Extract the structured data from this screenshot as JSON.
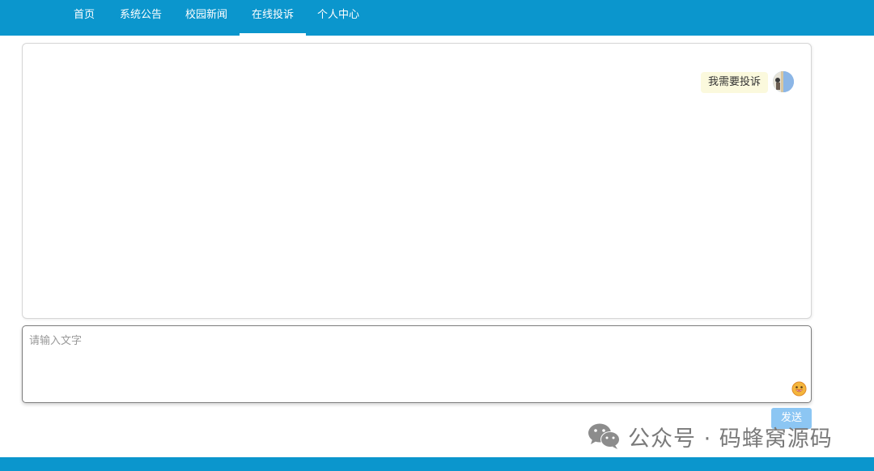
{
  "nav": {
    "items": [
      {
        "label": "首页"
      },
      {
        "label": "系统公告"
      },
      {
        "label": "校园新闻"
      },
      {
        "label": "在线投诉",
        "active": true
      },
      {
        "label": "个人中心"
      }
    ]
  },
  "chat": {
    "messages": [
      {
        "sender": "user",
        "text": "我需要投诉"
      }
    ]
  },
  "composer": {
    "placeholder": "请输入文字",
    "emoji_icon": "smile-emoji-icon",
    "send_label": "发送"
  },
  "watermark": {
    "text": "公众号 · 码蜂窝源码",
    "icon": "wechat-icon"
  },
  "colors": {
    "header": "#0b96cd",
    "bubble": "#fbf9dd",
    "send_button": "#8cc6f3"
  }
}
